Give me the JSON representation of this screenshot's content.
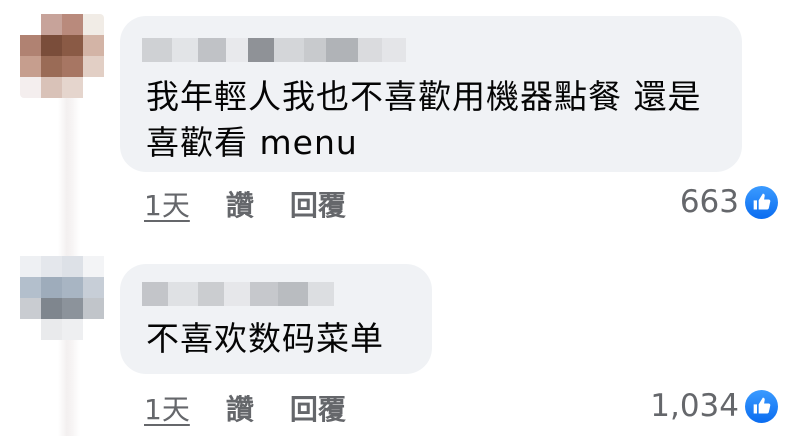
{
  "comments": [
    {
      "text": "我年輕人我也不喜歡用機器點餐 還是喜歡看 menu",
      "time": "1天",
      "like_label": "讚",
      "reply_label": "回覆",
      "reaction_count": "663",
      "reaction_icon": "thumbs-up-icon"
    },
    {
      "text": "不喜欢数码菜单",
      "time": "1天",
      "like_label": "讚",
      "reply_label": "回覆",
      "reaction_count": "1,034",
      "reaction_icon": "thumbs-up-icon"
    }
  ],
  "colors": {
    "bubble": "#f0f2f5",
    "text": "#050505",
    "secondary": "#65676b",
    "reaction_blue": "#0a6cf0"
  }
}
